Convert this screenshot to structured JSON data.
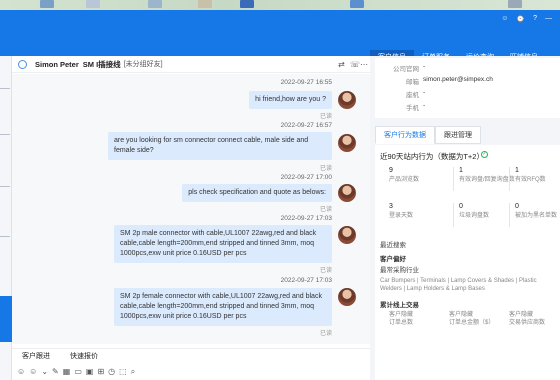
{
  "window": {
    "header_icons": [
      "☺",
      "⌚",
      "?",
      "—"
    ]
  },
  "top_tabs": [
    "客户信息",
    "订单服务",
    "运价查询",
    "旺铺信息"
  ],
  "chat": {
    "contact_name": "Simon Peter",
    "contact_tag": "SM I插接线",
    "contact_status": "[未分组好友]",
    "messages": [
      {
        "time": "2022-09-27 16:55",
        "text": "hi friend,how are you ?",
        "read": "已读"
      },
      {
        "time": "2022-09-27 16:57",
        "text": "are you looking for sm connector connect cable, male side and female side?",
        "read": "已读"
      },
      {
        "time": "2022-09-27 17:00",
        "text": "pls check specification and quote as belows:",
        "read": "已读"
      },
      {
        "time": "2022-09-27 17:03",
        "text": "SM 2p male connector with cable,UL1007 22awg,red and black cable,cable length=200mm,end stripped and tinned 3mm, moq 1000pcs,exw unit price 0.16USD per pcs",
        "read": "已读"
      },
      {
        "time": "2022-09-27 17:03",
        "text": "SM 2p female connector with cable,UL1007 22awg,red and black cable,cable length=200mm,end stripped and tinned 3mm, moq 1000pcs,exw unit price 0.16USD per pcs",
        "read": "已读"
      }
    ],
    "bottom_tabs": [
      "客户跟进",
      "快速报价"
    ],
    "toolbar_icons": [
      "☺",
      "☺",
      "⌄",
      "✎",
      "▦",
      "▭",
      "▣",
      "⊞",
      "◷",
      "⬚",
      "⌕"
    ]
  },
  "customer_info": {
    "rows": [
      {
        "label": "公司官网",
        "value": "-"
      },
      {
        "label": "邮箱",
        "value": "simon.peter@simpex.ch"
      },
      {
        "label": "座机",
        "value": "-"
      },
      {
        "label": "手机",
        "value": "-"
      }
    ]
  },
  "right_tabs": [
    "客户行为数据",
    "跟进管理"
  ],
  "behavior": {
    "title": "近90天站内行为（数据为T+2）",
    "ok_glyph": "✓",
    "stats": [
      {
        "num": "9",
        "label": "产品浏览数"
      },
      {
        "num": "1",
        "label": "有效询盘/回复询盘数"
      },
      {
        "num": "1",
        "label": "有效RFQ数"
      },
      {
        "num": "3",
        "label": "登录天数"
      },
      {
        "num": "0",
        "label": "垃圾询盘数"
      },
      {
        "num": "0",
        "label": "被加为黑名单数"
      }
    ],
    "recent_search": "最近搜索",
    "pref_title": "客户偏好",
    "pref_industry": "最常采购行业",
    "pref_detail": "Car Bumpers | Terminals | Lamp Covers & Shades | Plastic Welders | Lamp Holders & Lamp Bases",
    "trade_title": "累计线上交易",
    "trade_items": [
      {
        "line1": "客户隐藏",
        "line2": "订单总数"
      },
      {
        "line1": "客户隐藏",
        "line2": "订单总金额（$）"
      },
      {
        "line1": "客户隐藏",
        "line2": "交易供应商数"
      }
    ]
  }
}
